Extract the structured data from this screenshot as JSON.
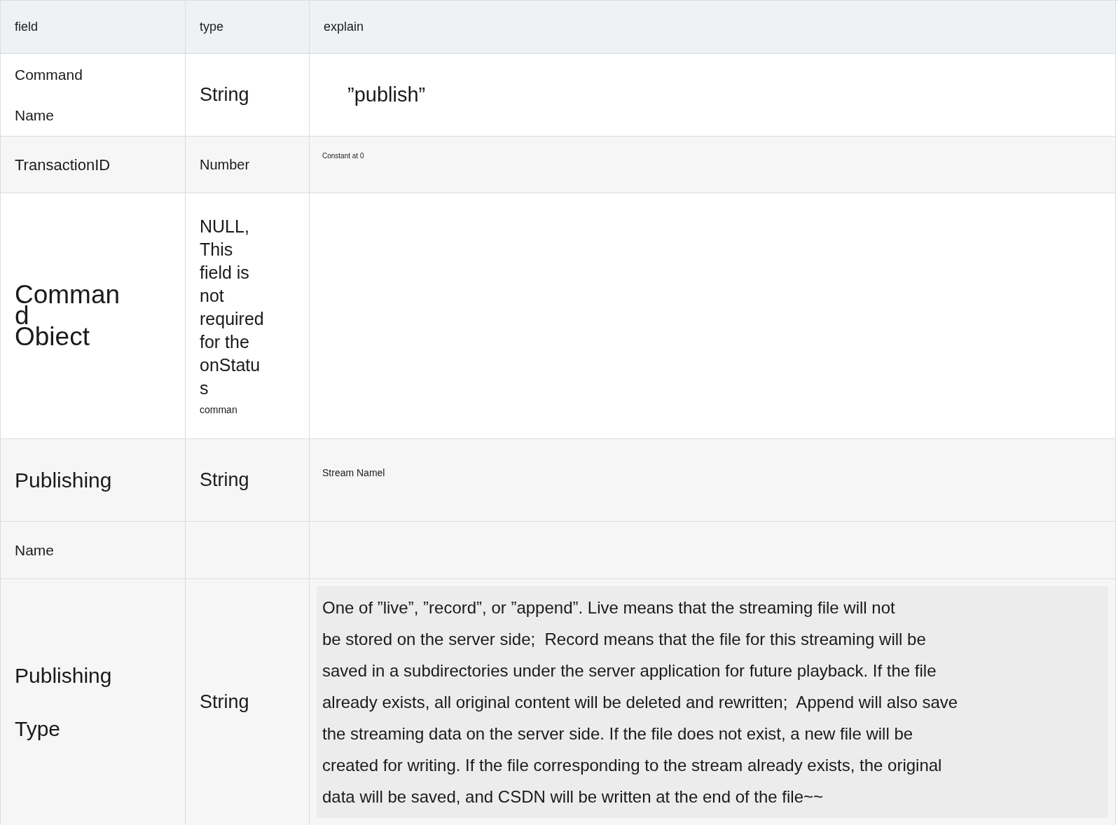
{
  "table": {
    "columns": [
      "field",
      "type",
      "explain"
    ],
    "rows": [
      {
        "field": "Command\nName",
        "type": "String",
        "explain": "”publish”"
      },
      {
        "field": "TransactionID",
        "type": "Number",
        "explain": "Constant at 0"
      },
      {
        "field": "Comman\nd\nObiect",
        "type": "NULL,\nThis\nfield is\nnot\nrequired\nfor the\nonStatu\ns",
        "type_note": "comman",
        "explain": ""
      },
      {
        "field": "Publishing",
        "type": "String",
        "explain": "Stream Namel"
      },
      {
        "field": "Name",
        "type": "",
        "explain": ""
      },
      {
        "field": "Publishing\nType",
        "type": "String",
        "explain": "One of ”live”, ”record”, or ”append”. Live means that the streaming file will not\nbe stored on the server side;  Record means that the file for this streaming will be\nsaved in a subdirectories under the server application for future playback. If the file\nalready exists, all original content will be deleted and rewritten;  Append will also save\nthe streaming data on the server side. If the file does not exist, a new file will be\ncreated for writing. If the file corresponding to the stream already exists, the original\ndata will be saved, and CSDN will be written at the end of the file~~"
      }
    ]
  }
}
